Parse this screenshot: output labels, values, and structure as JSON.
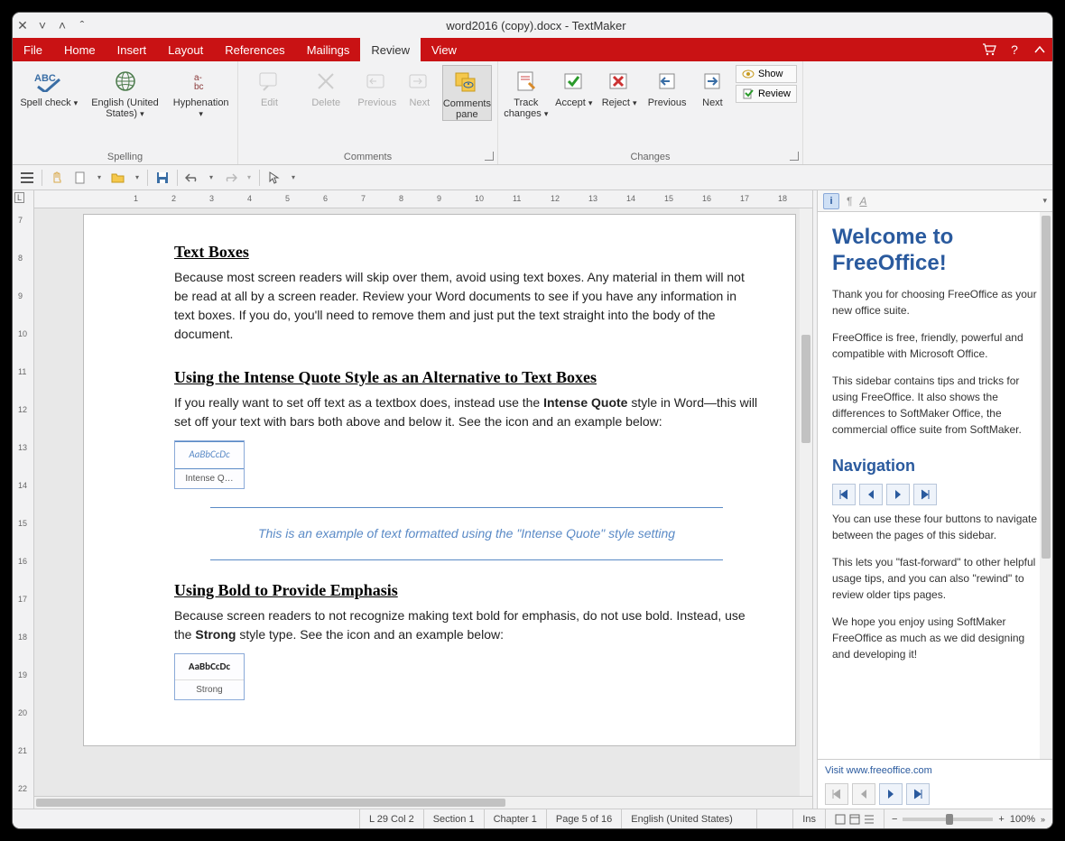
{
  "window": {
    "title": "word2016 (copy).docx - TextMaker"
  },
  "menu": {
    "items": [
      "File",
      "Home",
      "Insert",
      "Layout",
      "References",
      "Mailings",
      "Review",
      "View"
    ],
    "active": 6
  },
  "ribbon": {
    "groups": [
      {
        "label": "Spelling",
        "items": [
          {
            "key": "spell",
            "label": "Spell check",
            "dropdown": true
          },
          {
            "key": "lang",
            "label": "English (United States)",
            "dropdown": true
          },
          {
            "key": "hyph",
            "label": "Hyphenation",
            "dropdown": true
          }
        ]
      },
      {
        "label": "Comments",
        "items": [
          {
            "key": "cedit",
            "label": "Edit",
            "disabled": true
          },
          {
            "key": "cdel",
            "label": "Delete",
            "disabled": true
          },
          {
            "key": "cprev",
            "label": "Previous",
            "disabled": true
          },
          {
            "key": "cnext",
            "label": "Next",
            "disabled": true
          },
          {
            "key": "cpane",
            "label": "Comments pane",
            "active": true
          }
        ]
      },
      {
        "label": "Changes",
        "items": [
          {
            "key": "track",
            "label": "Track changes",
            "dropdown": true
          },
          {
            "key": "accept",
            "label": "Accept",
            "dropdown": true
          },
          {
            "key": "reject",
            "label": "Reject",
            "dropdown": true
          },
          {
            "key": "chprev",
            "label": "Previous"
          },
          {
            "key": "chnext",
            "label": "Next"
          }
        ],
        "side": [
          {
            "key": "show",
            "label": "Show"
          },
          {
            "key": "rev",
            "label": "Review"
          }
        ]
      }
    ]
  },
  "doc": {
    "h1": "Text Boxes",
    "p1": "Because most screen readers will skip over them, avoid using text boxes. Any material in them will not be read at all by a screen reader. Review your Word documents to see if you have any information in text boxes.  If you do, you'll need to remove them and just put the text straight into the body of the document.",
    "h2": "Using the Intense Quote Style as an Alternative to Text Boxes",
    "p2a": "If you really want to set off text as a textbox does, instead use the ",
    "p2b": "Intense Quote",
    "p2c": " style in Word—this will set off your text with bars both above and below it.  See the icon and an example below:",
    "style1": {
      "preview": "AaBbCcDc",
      "name": "Intense Q…"
    },
    "iq": "This is an example of text formatted using the \"Intense Quote\" style setting",
    "h3": "Using Bold to Provide Emphasis",
    "p3a": "Because screen readers to not recognize making text bold for emphasis, do not use bold.  Instead, use the ",
    "p3b": "Strong",
    "p3c": " style type. See the icon and an example below:",
    "style2": {
      "preview": "AaBbCcDc",
      "name": "Strong"
    }
  },
  "sidebar": {
    "title": "Welcome to FreeOffice!",
    "p1": "Thank you for choosing FreeOffice as your new office suite.",
    "p2": "FreeOffice is free, friendly, powerful and compatible with Microsoft Office.",
    "p3": "This sidebar contains tips and tricks for using FreeOffice. It also shows the differences to SoftMaker Office, the commercial office suite from SoftMaker.",
    "navh": "Navigation",
    "p4": "You can use these four buttons to navigate between the pages of this sidebar.",
    "p5": "This lets you \"fast-forward\" to other helpful usage tips, and you can also \"rewind\" to review older tips pages.",
    "p6": "We hope you enjoy using SoftMaker FreeOffice as much as we did designing and developing it!",
    "link": "Visit www.freeoffice.com"
  },
  "status": {
    "pos": "L 29 Col 2",
    "section": "Section 1",
    "chapter": "Chapter 1",
    "page": "Page 5 of 16",
    "lang": "English (United States)",
    "ins": "Ins",
    "zoom": "100%"
  },
  "ruler": {
    "label": "L",
    "h": [
      1,
      2,
      3,
      4,
      5,
      6,
      7,
      8,
      9,
      10,
      11,
      12,
      13,
      14,
      15,
      16,
      17,
      18
    ],
    "v": [
      7,
      8,
      9,
      10,
      11,
      12,
      13,
      14,
      15,
      16,
      17,
      18,
      19,
      20,
      21,
      22
    ]
  }
}
